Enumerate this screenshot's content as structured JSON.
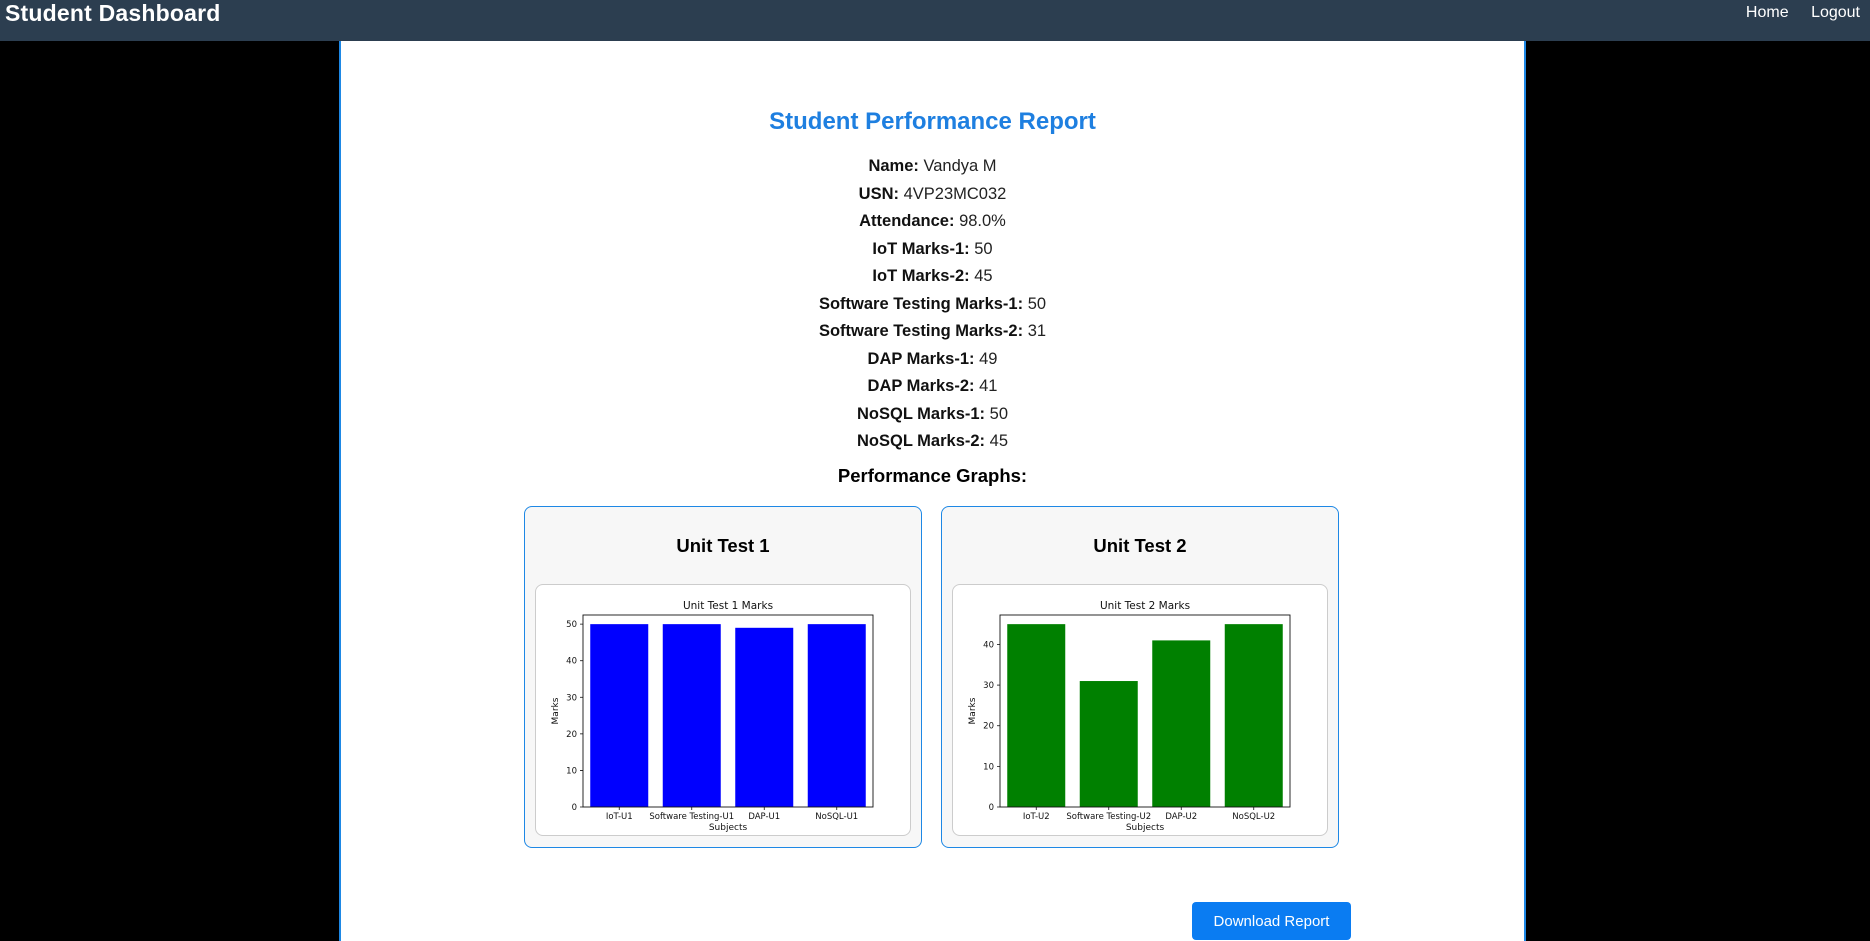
{
  "header": {
    "title": "Student Dashboard",
    "nav": [
      "Home",
      "Logout"
    ]
  },
  "report": {
    "title": "Student Performance Report",
    "fields": [
      {
        "label": "Name:",
        "value": "Vandya M"
      },
      {
        "label": "USN:",
        "value": "4VP23MC032"
      },
      {
        "label": "Attendance:",
        "value": "98.0%"
      },
      {
        "label": "IoT Marks-1:",
        "value": "50"
      },
      {
        "label": "IoT Marks-2:",
        "value": "45"
      },
      {
        "label": "Software Testing Marks-1:",
        "value": "50"
      },
      {
        "label": "Software Testing Marks-2:",
        "value": "31"
      },
      {
        "label": "DAP Marks-1:",
        "value": "49"
      },
      {
        "label": "DAP Marks-2:",
        "value": "41"
      },
      {
        "label": "NoSQL Marks-1:",
        "value": "50"
      },
      {
        "label": "NoSQL Marks-2:",
        "value": "45"
      }
    ],
    "graphs_heading": "Performance Graphs:",
    "download_label": "Download Report"
  },
  "cards": [
    {
      "heading": "Unit Test 1"
    },
    {
      "heading": "Unit Test 2"
    }
  ],
  "chart_data": [
    {
      "type": "bar",
      "title": "Unit Test 1 Marks",
      "xlabel": "Subjects",
      "ylabel": "Marks",
      "categories": [
        "IoT-U1",
        "Software Testing-U1",
        "DAP-U1",
        "NoSQL-U1"
      ],
      "values": [
        50,
        50,
        49,
        50
      ],
      "yticks": [
        0,
        10,
        20,
        30,
        40,
        50
      ],
      "ylim": [
        0,
        52.5
      ],
      "color": "#0000ff",
      "grid": false
    },
    {
      "type": "bar",
      "title": "Unit Test 2 Marks",
      "xlabel": "Subjects",
      "ylabel": "Marks",
      "categories": [
        "IoT-U2",
        "Software Testing-U2",
        "DAP-U2",
        "NoSQL-U2"
      ],
      "values": [
        45,
        31,
        41,
        45
      ],
      "yticks": [
        0,
        10,
        20,
        30,
        40
      ],
      "ylim": [
        0,
        47.25
      ],
      "color": "#008000",
      "grid": false
    }
  ]
}
